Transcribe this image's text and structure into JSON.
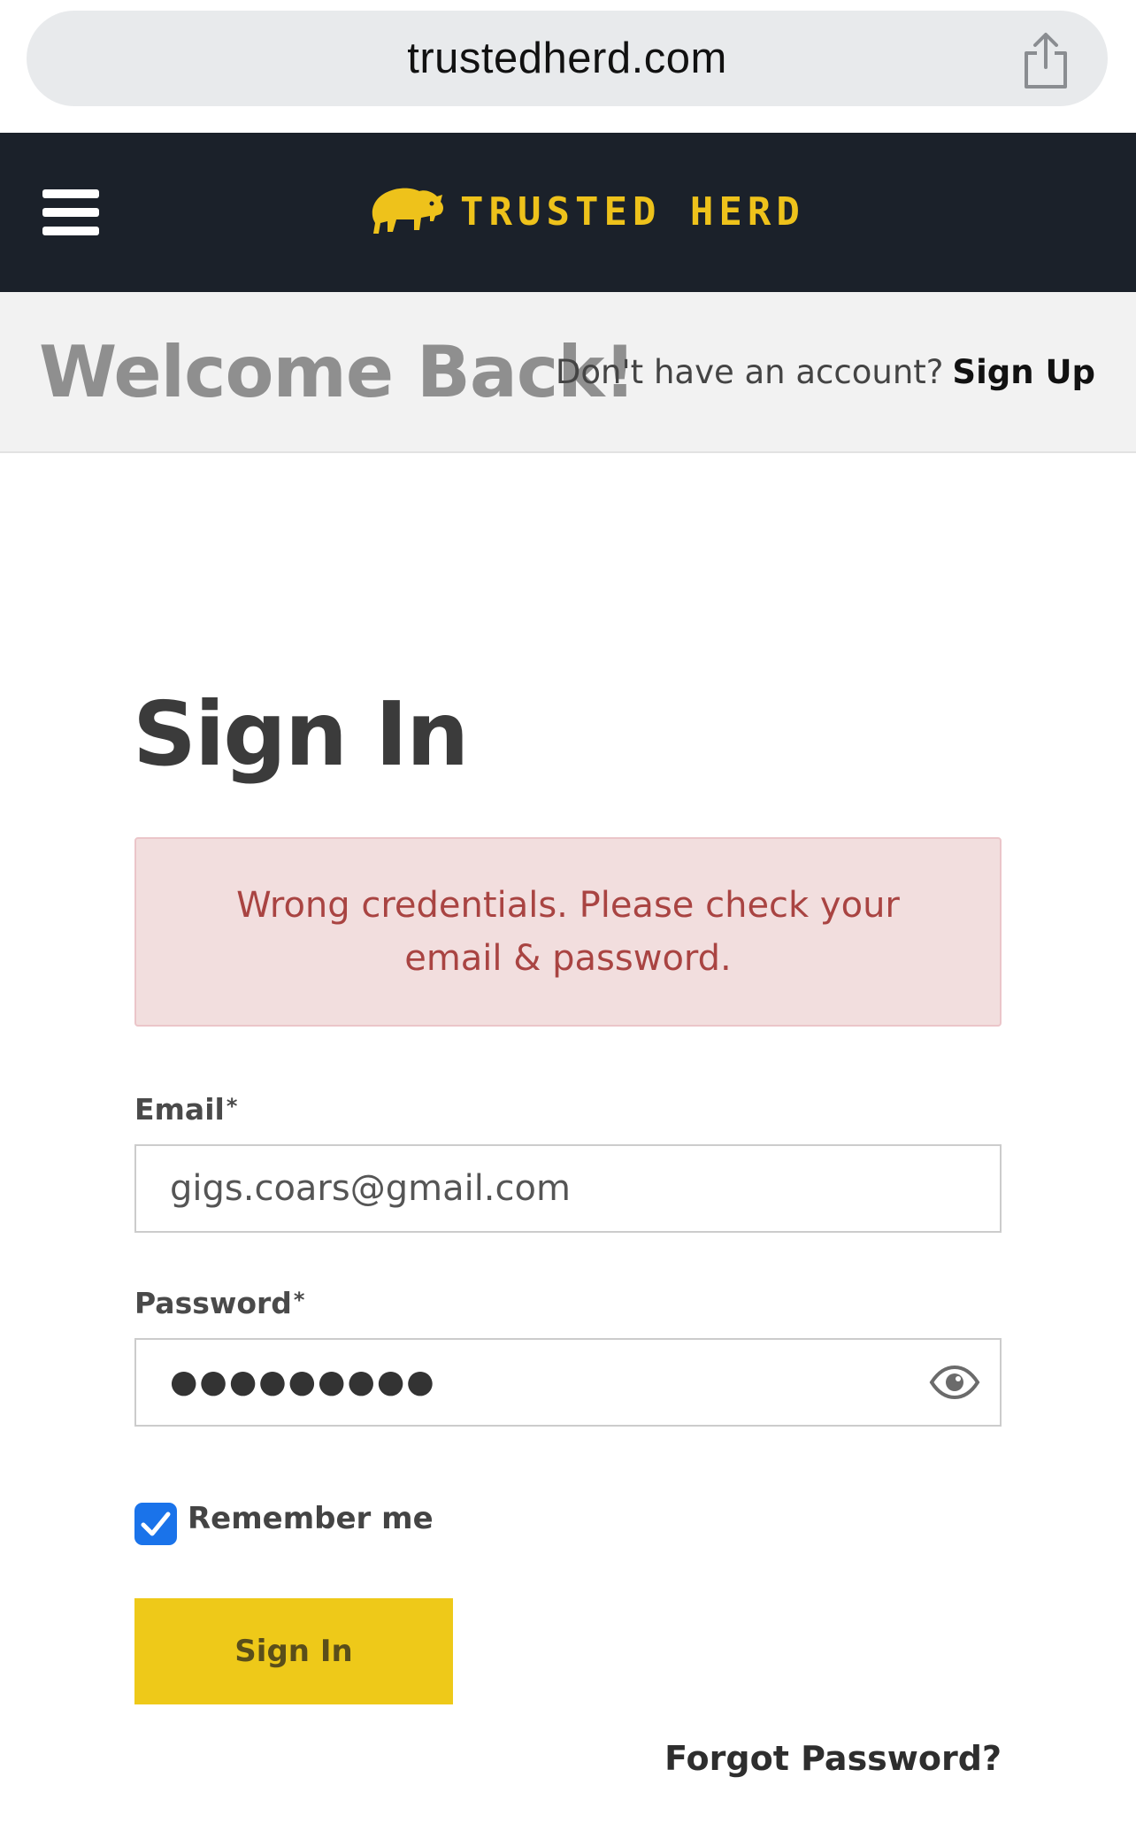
{
  "browser": {
    "url": "trustedherd.com",
    "share_icon": "share-icon"
  },
  "header": {
    "menu_icon": "hamburger-menu-icon",
    "brand_name": "TRUSTED HERD",
    "brand_logo": "bison-logo",
    "brand_color": "#eec21b",
    "background_color": "#1b212a"
  },
  "welcome": {
    "title": "Welcome Back!",
    "signup_prompt": "Don't have an account?",
    "signup_link": "Sign Up"
  },
  "form": {
    "title": "Sign In",
    "alert": {
      "message": "Wrong credentials. Please check your email & password.",
      "color": "#a94442",
      "background": "#f2dede"
    },
    "email": {
      "label": "Email",
      "required_mark": "*",
      "value": "gigs.coars@gmail.com"
    },
    "password": {
      "label": "Password",
      "required_mark": "*",
      "masked_value": "●●●●●●●●●",
      "toggle_icon": "eye-icon"
    },
    "remember_me": {
      "label": "Remember me",
      "checked": true,
      "color": "#1a73ea"
    },
    "submit_label": "Sign In",
    "submit_color": "#eec919",
    "forgot_password": "Forgot Password?"
  }
}
